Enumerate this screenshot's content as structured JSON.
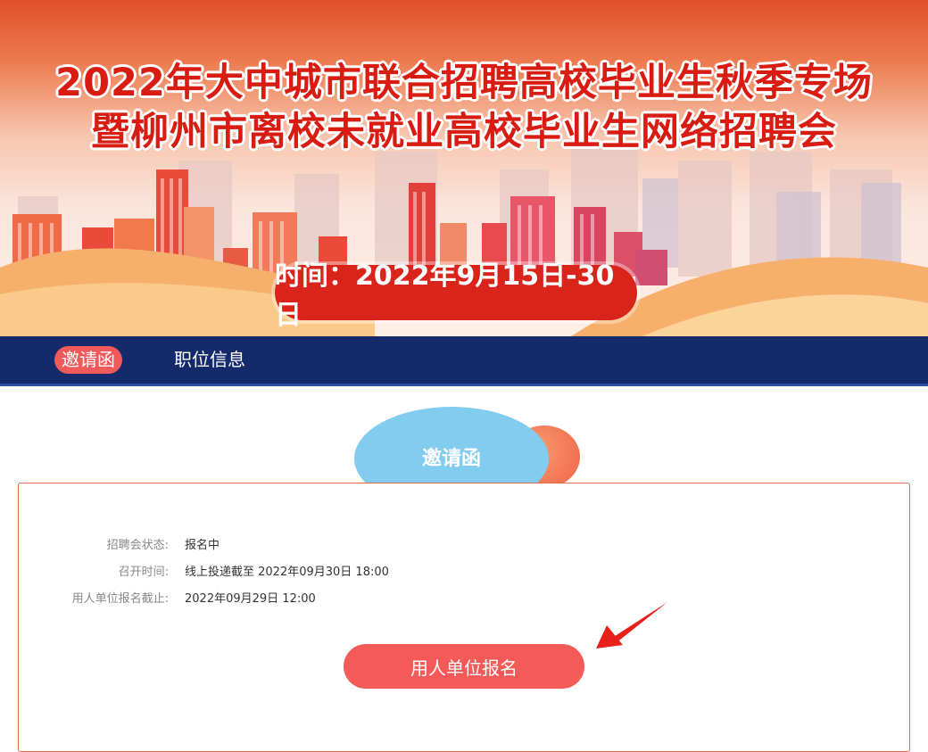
{
  "banner": {
    "title_line1": "2022年大中城市联合招聘高校毕业生秋季专场",
    "title_line2": "暨柳州市离校未就业高校毕业生网络招聘会",
    "date_label": "时间：2022年9月15日-30日"
  },
  "nav": {
    "tabs": [
      {
        "label": "邀请函",
        "active": true
      },
      {
        "label": "职位信息",
        "active": false
      }
    ]
  },
  "section": {
    "heading": "邀请函"
  },
  "info": {
    "rows": [
      {
        "label": "招聘会状态:",
        "value": "报名中"
      },
      {
        "label": "召开时间:",
        "value": "线上投递截至 2022年09月30日 18:00"
      },
      {
        "label": "用人单位报名截止:",
        "value": "2022年09月29日 12:00"
      }
    ]
  },
  "actions": {
    "signup_label": "用人单位报名"
  },
  "colors": {
    "accent_red": "#f45a57",
    "nav_bg": "#142a6b",
    "title_red": "#d81c12",
    "bubble_blue": "#82ccf0"
  }
}
